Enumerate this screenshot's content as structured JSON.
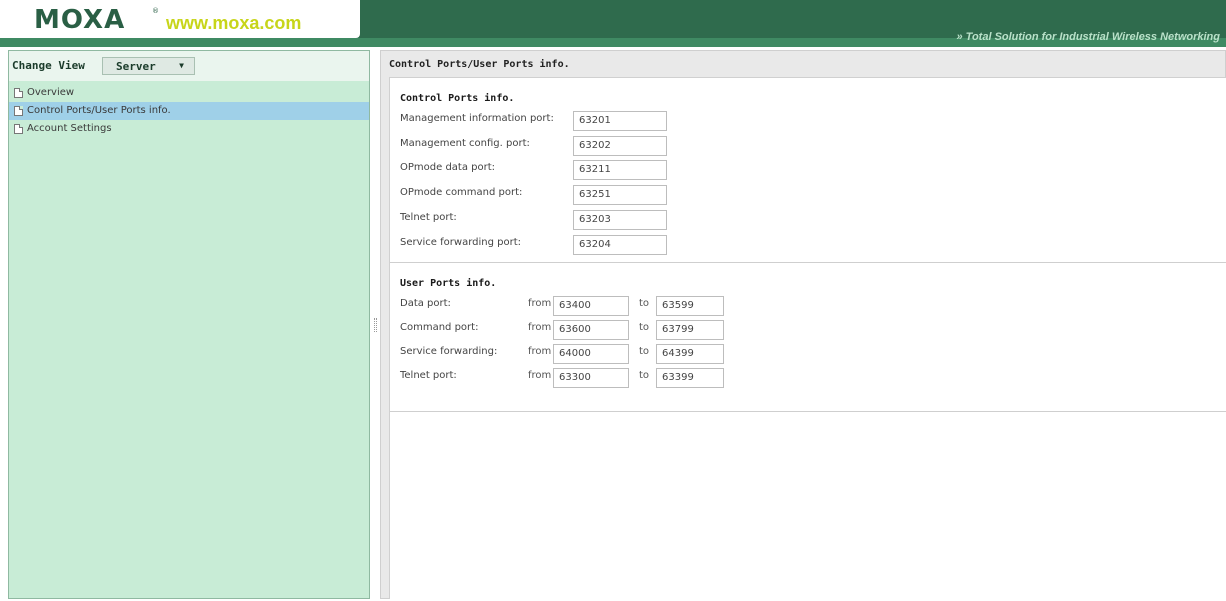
{
  "header": {
    "logo_text": "MOXA",
    "site_text": "www.moxa.com",
    "tagline": "» Total Solution for Industrial Wireless Networking"
  },
  "sidebar": {
    "change_view_label": "Change View",
    "view_select_value": "Server",
    "items": [
      {
        "label": "Overview",
        "selected": false
      },
      {
        "label": "Control Ports/User Ports info.",
        "selected": true
      },
      {
        "label": "Account Settings",
        "selected": false
      }
    ]
  },
  "main": {
    "title": "Control Ports/User Ports info.",
    "control_ports": {
      "heading": "Control Ports info.",
      "rows": [
        {
          "label": "Management information port:",
          "value": "63201"
        },
        {
          "label": "Management config. port:",
          "value": "63202"
        },
        {
          "label": "OPmode data port:",
          "value": "63211"
        },
        {
          "label": "OPmode command port:",
          "value": "63251"
        },
        {
          "label": "Telnet port:",
          "value": "63203"
        },
        {
          "label": "Service forwarding port:",
          "value": "63204"
        }
      ]
    },
    "user_ports": {
      "heading": "User Ports info.",
      "from_label": "from",
      "to_label": "to",
      "rows": [
        {
          "label": "Data port:",
          "from": "63400",
          "to": "63599"
        },
        {
          "label": "Command port:",
          "from": "63600",
          "to": "63799"
        },
        {
          "label": "Service forwarding:",
          "from": "64000",
          "to": "64399"
        },
        {
          "label": "Telnet port:",
          "from": "63300",
          "to": "63399"
        }
      ]
    }
  },
  "colors": {
    "header_green": "#2f6b4d",
    "sidebar_bg": "#c8ecd6",
    "selected_item": "#9fd0e8",
    "site_text": "#c7d51a"
  },
  "icons": {
    "tree_item": "document-icon",
    "dropdown": "chevron-down-icon"
  }
}
